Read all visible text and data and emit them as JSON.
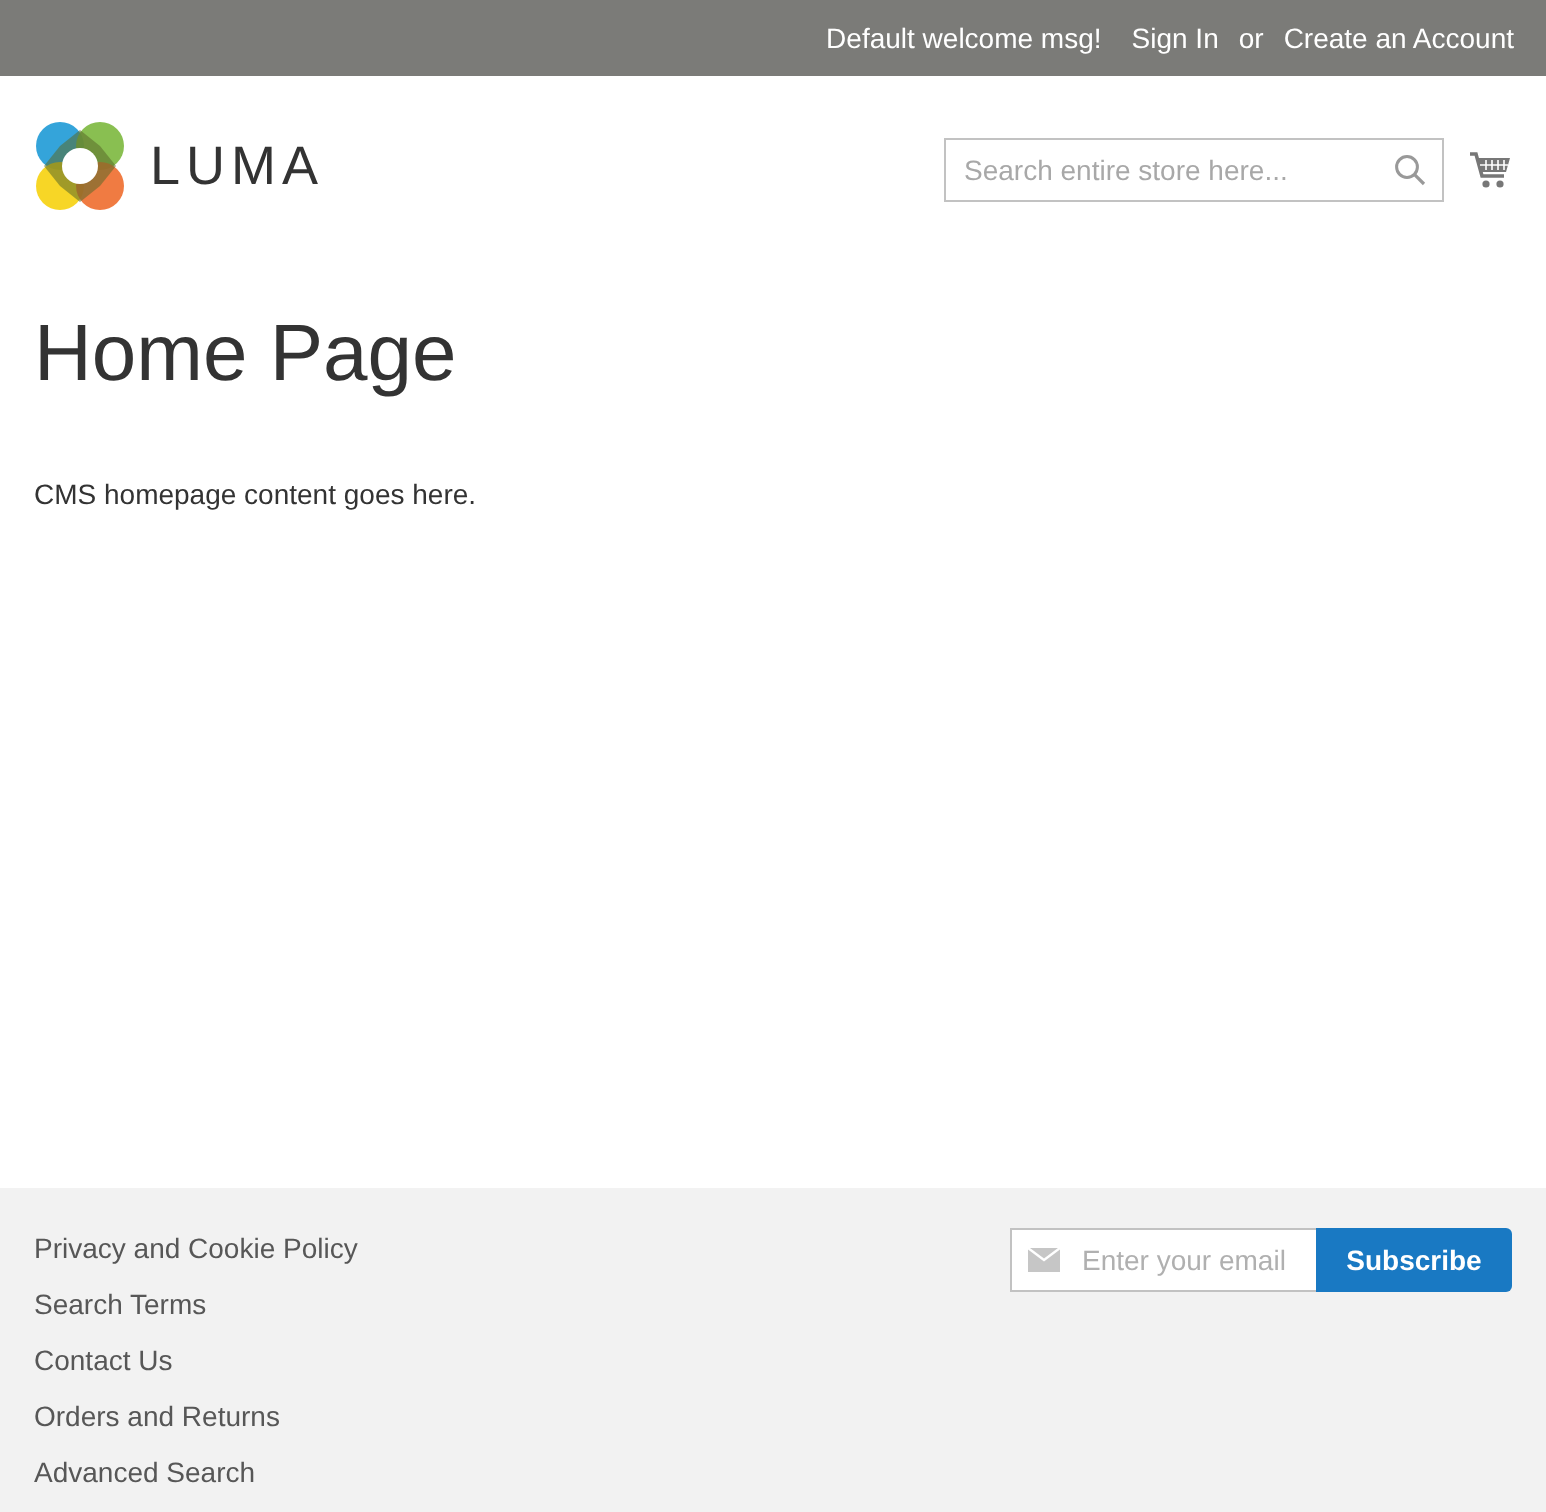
{
  "top_bar": {
    "welcome": "Default welcome msg!",
    "sign_in": "Sign In",
    "separator": "or",
    "create_account": "Create an Account"
  },
  "header": {
    "logo_text": "LUMA",
    "search": {
      "placeholder": "Search entire store here..."
    }
  },
  "main": {
    "title": "Home Page",
    "content": "CMS homepage content goes here."
  },
  "footer": {
    "links": [
      "Privacy and Cookie Policy",
      "Search Terms",
      "Contact Us",
      "Orders and Returns",
      "Advanced Search"
    ],
    "newsletter": {
      "placeholder": "Enter your email",
      "button": "Subscribe"
    }
  }
}
